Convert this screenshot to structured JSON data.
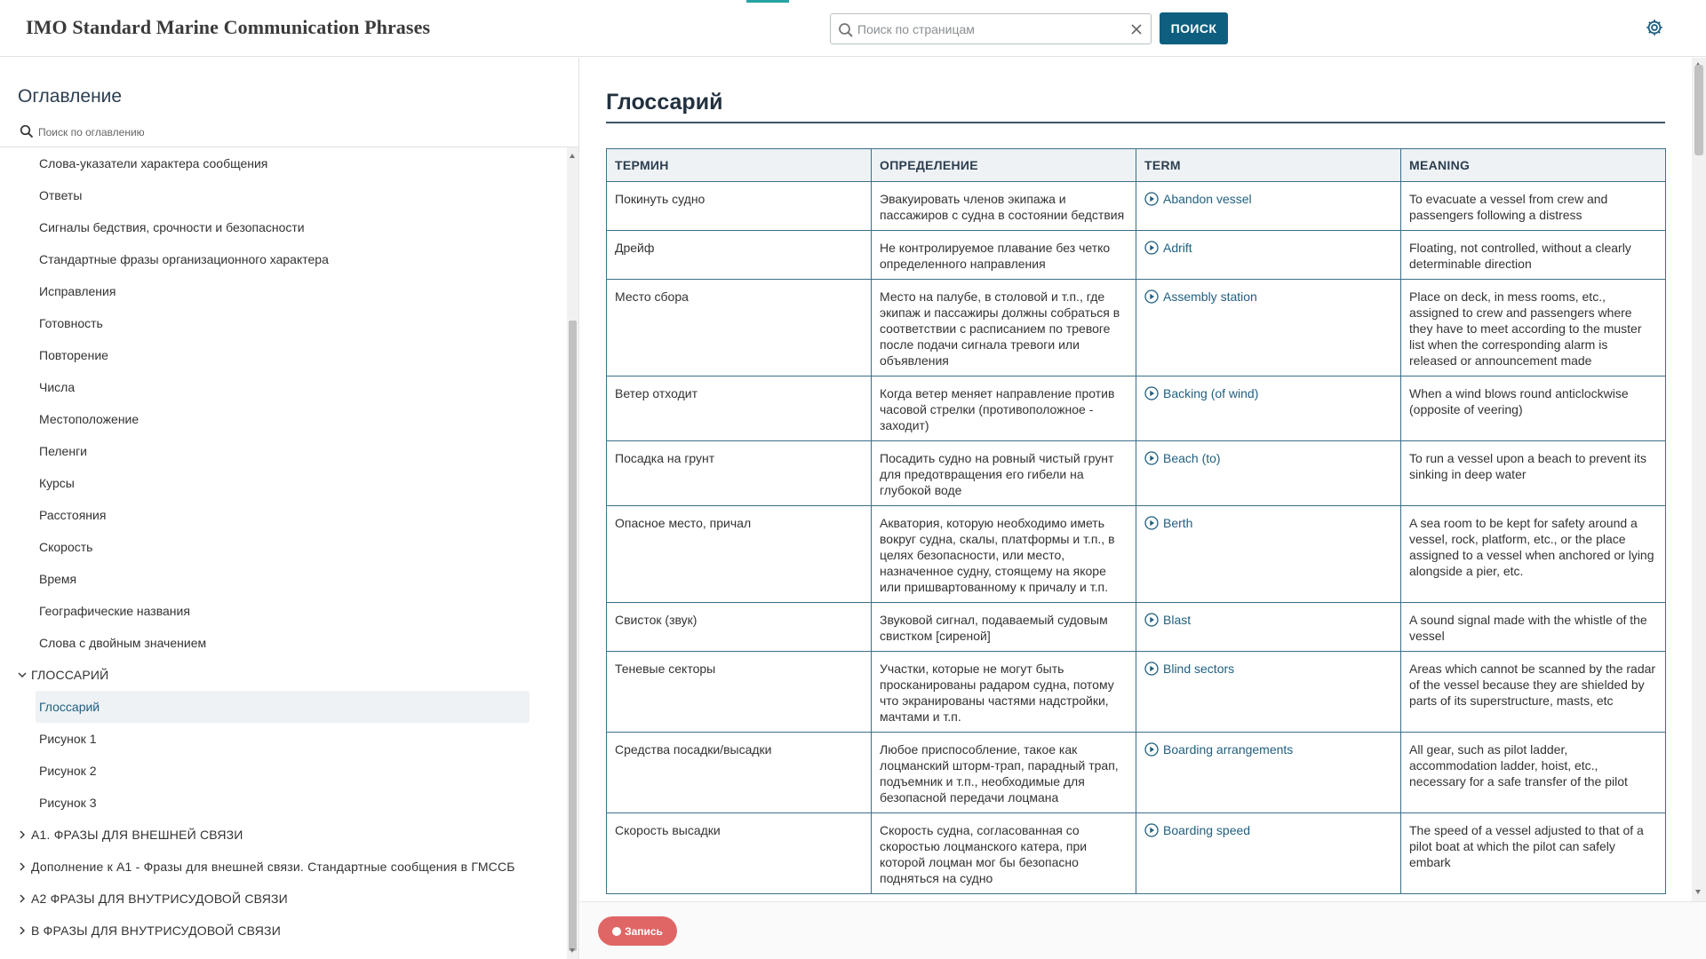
{
  "header": {
    "app_title": "IMO Standard Marine Communication Phrases",
    "search_placeholder": "Поиск по страницам",
    "search_button": "ПОИСК"
  },
  "sidebar": {
    "title": "Оглавление",
    "search_placeholder": "Поиск по оглавлению",
    "items": [
      {
        "label": "Слова-указатели характера сообщения",
        "kind": "item"
      },
      {
        "label": "Ответы",
        "kind": "item"
      },
      {
        "label": "Сигналы бедствия, срочности и безопасности",
        "kind": "item"
      },
      {
        "label": "Стандартные фразы организационного характера",
        "kind": "item"
      },
      {
        "label": "Исправления",
        "kind": "item"
      },
      {
        "label": "Готовность",
        "kind": "item"
      },
      {
        "label": "Повторение",
        "kind": "item"
      },
      {
        "label": "Числа",
        "kind": "item"
      },
      {
        "label": "Местоположение",
        "kind": "item"
      },
      {
        "label": "Пеленги",
        "kind": "item"
      },
      {
        "label": "Курсы",
        "kind": "item"
      },
      {
        "label": "Расстояния",
        "kind": "item"
      },
      {
        "label": "Скорость",
        "kind": "item"
      },
      {
        "label": "Время",
        "kind": "item"
      },
      {
        "label": "Географические названия",
        "kind": "item"
      },
      {
        "label": "Слова с двойным значением",
        "kind": "item"
      },
      {
        "label": "ГЛОССАРИЙ",
        "kind": "section",
        "expanded": true
      },
      {
        "label": "Глоссарий",
        "kind": "item",
        "active": true
      },
      {
        "label": "Рисунок 1",
        "kind": "item"
      },
      {
        "label": "Рисунок 2",
        "kind": "item"
      },
      {
        "label": "Рисунок 3",
        "kind": "item"
      },
      {
        "label": "A1. ФРАЗЫ ДЛЯ ВНЕШНЕЙ СВЯЗИ",
        "kind": "section",
        "expanded": false
      },
      {
        "label": "Дополнение к А1 - Фразы для внешней связи. Стандартные сообщения в ГМССБ",
        "kind": "section",
        "expanded": false
      },
      {
        "label": "A2 ФРАЗЫ ДЛЯ ВНУТРИСУДОВОЙ СВЯЗИ",
        "kind": "section",
        "expanded": false
      },
      {
        "label": "B ФРАЗЫ ДЛЯ ВНУТРИСУДОВОЙ СВЯЗИ",
        "kind": "section",
        "expanded": false
      }
    ]
  },
  "main": {
    "heading": "Глоссарий",
    "columns": [
      "ТЕРМИН",
      "ОПРЕДЕЛЕНИЕ",
      "TERM",
      "MEANING"
    ],
    "rows": [
      [
        "Покинуть судно",
        "Эвакуировать членов экипажа и пассажиров с судна в состоянии бедствия",
        "Abandon vessel",
        "To evacuate a vessel from crew and passengers following a distress"
      ],
      [
        "Дрейф",
        "Не контролируемое плавание без четко определенного направления",
        "Adrift",
        "Floating, not controlled, without a clearly determinable direction"
      ],
      [
        "Место сбора",
        "Место на палубе, в столовой и т.п., где экипаж и пассажиры должны собраться в соответствии с расписанием по тревоге после подачи сигнала тревоги или объявления",
        "Assembly station",
        "Place on deck, in mess rooms, etc., assigned to crew and passengers where they have to meet according to the muster list when the corresponding alarm is released or announcement made"
      ],
      [
        "Ветер отходит",
        "Когда ветер меняет направление против часовой стрелки (противоположное - заходит)",
        "Backing (of wind)",
        "When a wind blows round anticlockwise (opposite of veering)"
      ],
      [
        "Посадка на грунт",
        "Посадить судно на ровный чистый грунт для предотвращения его гибели на глубокой воде",
        "Beach (to)",
        "To run a vessel upon a beach to prevent its sinking in deep water"
      ],
      [
        "Опасное место, причал",
        "Акватория, которую необходимо иметь вокруг судна, скалы, платформы и т.п., в целях безопасности, или место, назначенное судну, стоящему на якоре или пришвартованному к причалу и т.п.",
        "Berth",
        "A sea room to be kept for safety around a vessel, rock, platform, etc., or the place assigned to a vessel when anchored or lying alongside a pier, etc."
      ],
      [
        "Свисток (звук)",
        "Звуковой сигнал, подаваемый судовым свистком [сиреной]",
        "Blast",
        "A sound signal made with the whistle of the vessel"
      ],
      [
        "Теневые секторы",
        "Участки, которые не могут быть просканированы радаром судна, потому что экранированы частями надстройки, мачтами и т.п.",
        "Blind sectors",
        "Areas which cannot be scanned by the radar of the vessel because they are shielded by parts of its superstructure, masts, etc"
      ],
      [
        "Средства посадки/высадки",
        "Любое приспособление, такое как лоцманский шторм-трап, парадный трап, подъемник и т.п., необходимые для безопасной передачи лоцмана",
        "Boarding arrangements",
        "All gear, such as pilot ladder, accommodation ladder, hoist, etc., necessary for a safe transfer of the pilot"
      ],
      [
        "Скорость высадки",
        "Скорость судна, согласованная со скоростью лоцманского катера, при которой лоцман мог бы безопасно подняться на судно",
        "Boarding speed",
        "The speed of a vessel adjusted to that of a pilot boat at which the pilot can safely embark"
      ]
    ]
  },
  "footer": {
    "record_button": "Запись"
  },
  "colors": {
    "primary": "#0e5f7f",
    "link": "#1f5f7f",
    "record": "#e06666",
    "accent": "#28a3a3"
  }
}
